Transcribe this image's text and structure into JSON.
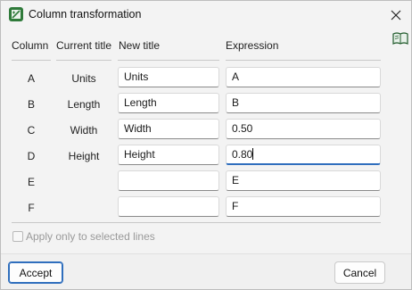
{
  "window": {
    "title": "Column transformation"
  },
  "headers": {
    "column": "Column",
    "current_title": "Current title",
    "new_title": "New title",
    "expression": "Expression"
  },
  "rows": [
    {
      "column": "A",
      "current_title": "Units",
      "new_title": "Units",
      "expression": "A"
    },
    {
      "column": "B",
      "current_title": "Length",
      "new_title": "Length",
      "expression": "B"
    },
    {
      "column": "C",
      "current_title": "Width",
      "new_title": "Width",
      "expression": "0.50"
    },
    {
      "column": "D",
      "current_title": "Height",
      "new_title": "Height",
      "expression": "0.80"
    },
    {
      "column": "E",
      "current_title": "",
      "new_title": "",
      "expression": "E"
    },
    {
      "column": "F",
      "current_title": "",
      "new_title": "",
      "expression": "F"
    }
  ],
  "options": {
    "apply_selected_label": "Apply only to selected lines",
    "apply_selected_checked": false
  },
  "buttons": {
    "accept": "Accept",
    "cancel": "Cancel"
  },
  "icons": {
    "app": "table-transform-icon",
    "close": "close-icon",
    "help": "help-book-icon"
  },
  "colors": {
    "accent": "#2f6ebd",
    "app_icon": "#2f7a3a"
  }
}
